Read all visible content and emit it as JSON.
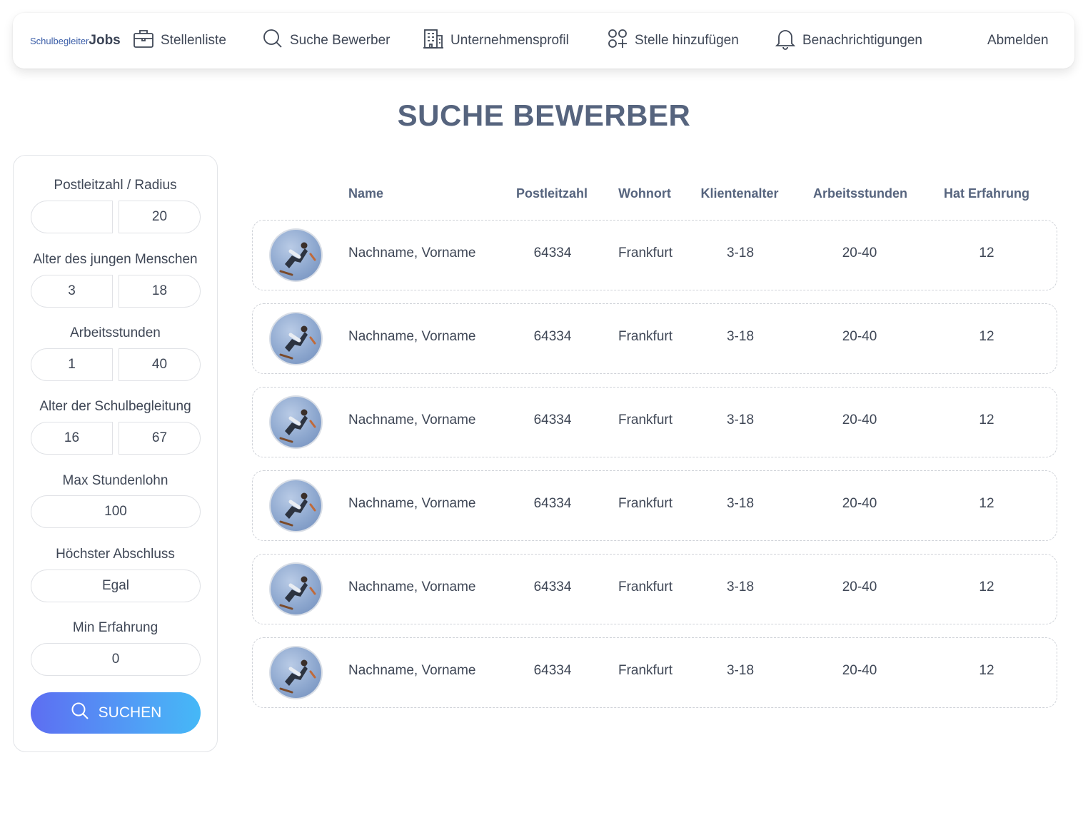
{
  "nav": {
    "logo_small": "Schulbegleiter",
    "logo_bold": "Jobs",
    "items": [
      {
        "label": "Stellenliste",
        "icon": "briefcase-icon"
      },
      {
        "label": "Suche Bewerber",
        "icon": "search-icon"
      },
      {
        "label": "Unternehmensprofil",
        "icon": "building-icon"
      },
      {
        "label": "Stelle hinzufügen",
        "icon": "add-grid-icon"
      },
      {
        "label": "Benachrichtigungen",
        "icon": "bell-icon"
      }
    ],
    "logout": "Abmelden"
  },
  "page_title": "SUCHE BEWERBER",
  "filters": {
    "plz_label": "Postleitzahl / Radius",
    "plz_value": "",
    "radius_value": "20",
    "age_young_label": "Alter des jungen Menschen",
    "age_young_min": "3",
    "age_young_max": "18",
    "hours_label": "Arbeitsstunden",
    "hours_min": "1",
    "hours_max": "40",
    "age_companion_label": "Alter der Schulbegleitung",
    "age_companion_min": "16",
    "age_companion_max": "67",
    "max_wage_label": "Max Stundenlohn",
    "max_wage_value": "100",
    "degree_label": "Höchster Abschluss",
    "degree_value": "Egal",
    "min_exp_label": "Min Erfahrung",
    "min_exp_value": "0",
    "search_button": "SUCHEN"
  },
  "table": {
    "headers": {
      "name": "Name",
      "plz": "Postleitzahl",
      "ort": "Wohnort",
      "klientenalter": "Klientenalter",
      "arbeitsstunden": "Arbeitsstunden",
      "erfahrung": "Hat Erfahrung"
    },
    "rows": [
      {
        "name": "Nachname, Vorname",
        "plz": "64334",
        "ort": "Frankfurt",
        "klientenalter": "3-18",
        "arbeitsstunden": "20-40",
        "erfahrung": "12"
      },
      {
        "name": "Nachname, Vorname",
        "plz": "64334",
        "ort": "Frankfurt",
        "klientenalter": "3-18",
        "arbeitsstunden": "20-40",
        "erfahrung": "12"
      },
      {
        "name": "Nachname, Vorname",
        "plz": "64334",
        "ort": "Frankfurt",
        "klientenalter": "3-18",
        "arbeitsstunden": "20-40",
        "erfahrung": "12"
      },
      {
        "name": "Nachname, Vorname",
        "plz": "64334",
        "ort": "Frankfurt",
        "klientenalter": "3-18",
        "arbeitsstunden": "20-40",
        "erfahrung": "12"
      },
      {
        "name": "Nachname, Vorname",
        "plz": "64334",
        "ort": "Frankfurt",
        "klientenalter": "3-18",
        "arbeitsstunden": "20-40",
        "erfahrung": "12"
      },
      {
        "name": "Nachname, Vorname",
        "plz": "64334",
        "ort": "Frankfurt",
        "klientenalter": "3-18",
        "arbeitsstunden": "20-40",
        "erfahrung": "12"
      }
    ]
  },
  "colors": {
    "accent_start": "#5d6ef2",
    "accent_end": "#45b8f7",
    "title": "#56647e",
    "text": "#3f4756"
  }
}
